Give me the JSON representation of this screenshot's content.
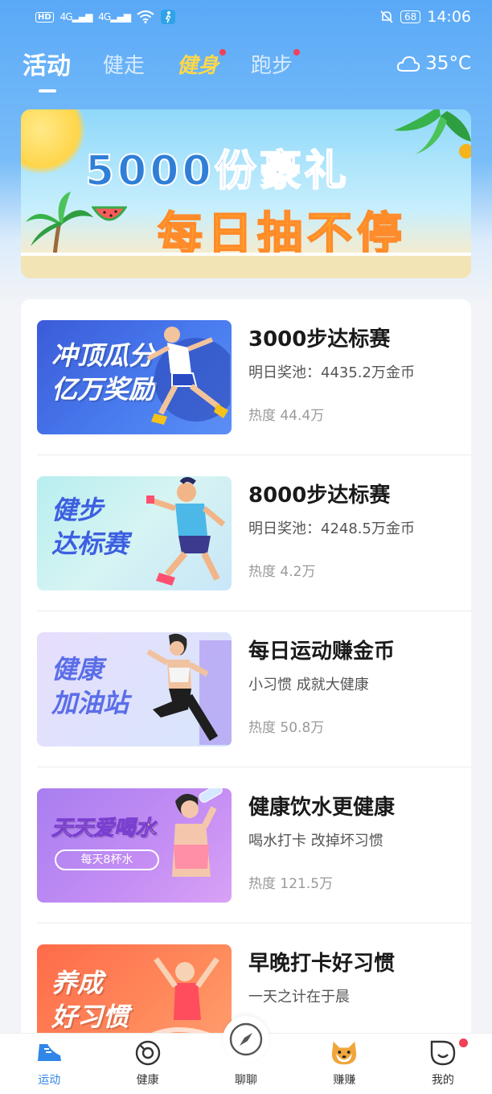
{
  "status_bar": {
    "hd": "HD",
    "sig1": "4G",
    "sig2": "4G",
    "battery": "68",
    "time": "14:06"
  },
  "top_tabs": [
    {
      "label": "活动",
      "active": true
    },
    {
      "label": "健走",
      "active": false
    },
    {
      "label": "健身",
      "active": false,
      "dot": true
    },
    {
      "label": "跑步",
      "active": false,
      "dot": true
    }
  ],
  "weather": {
    "temp": "35°C",
    "icon": "cloud-icon"
  },
  "banner": {
    "line1": "5000份豪礼",
    "line2": "每日抽不停"
  },
  "activities": [
    {
      "thumb_text": [
        "冲顶瓜分",
        "亿万奖励"
      ],
      "title": "3000步达标赛",
      "subtitle": "明日奖池：4435.2万金币",
      "heat": "热度 44.4万"
    },
    {
      "thumb_text": [
        "健步",
        "达标赛"
      ],
      "title": "8000步达标赛",
      "subtitle": "明日奖池：4248.5万金币",
      "heat": "热度 4.2万"
    },
    {
      "thumb_text": [
        "健康",
        "加油站"
      ],
      "title": "每日运动赚金币",
      "subtitle": "小习惯 成就大健康",
      "heat": "热度 50.8万"
    },
    {
      "thumb_text": [
        "天天爱喝水",
        "每天8杯水"
      ],
      "title": "健康饮水更健康",
      "subtitle": "喝水打卡 改掉坏习惯",
      "heat": "热度 121.5万"
    },
    {
      "thumb_text": [
        "养成",
        "好习惯"
      ],
      "title": "早晚打卡好习惯",
      "subtitle": "一天之计在于晨",
      "heat": ""
    }
  ],
  "bottom_nav": [
    {
      "label": "运动",
      "icon": "shoe-icon",
      "active": true
    },
    {
      "label": "健康",
      "icon": "health-ring-icon",
      "active": false
    },
    {
      "label": "聊聊",
      "icon": "compass-icon",
      "active": false
    },
    {
      "label": "赚赚",
      "icon": "shiba-dog-icon",
      "active": false
    },
    {
      "label": "我的",
      "icon": "profile-icon",
      "active": false,
      "dot": true
    }
  ],
  "colors": {
    "accent": "#2f86e8",
    "header_blue": "#5aa9f7",
    "tab_highlight": "#ffd84a",
    "badge_red": "#f0405a"
  }
}
